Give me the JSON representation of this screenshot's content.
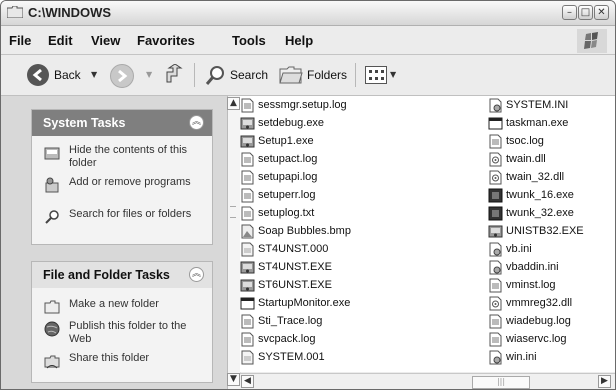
{
  "window": {
    "title": "C:\\WINDOWS"
  },
  "menu": [
    "File",
    "Edit",
    "View",
    "Favorites",
    "Tools",
    "Help"
  ],
  "toolbar": {
    "back": "Back",
    "search": "Search",
    "folders": "Folders"
  },
  "system_tasks": {
    "title": "System Tasks",
    "items": [
      {
        "label": "Hide the contents of this folder",
        "icon": "folder-hide-icon"
      },
      {
        "label": "Add or remove programs",
        "icon": "add-remove-programs-icon"
      },
      {
        "label": "Search for files or folders",
        "icon": "search-icon"
      }
    ]
  },
  "file_folder_tasks": {
    "title": "File and Folder Tasks",
    "items": [
      {
        "label": "Make a new folder",
        "icon": "new-folder-icon"
      },
      {
        "label": "Publish this folder to the Web",
        "icon": "globe-icon"
      },
      {
        "label": "Share this folder",
        "icon": "share-icon"
      }
    ]
  },
  "files_col1": [
    {
      "name": "sessmgr.setup.log",
      "icon": "text-file"
    },
    {
      "name": "setdebug.exe",
      "icon": "exe"
    },
    {
      "name": "Setup1.exe",
      "icon": "exe"
    },
    {
      "name": "setupact.log",
      "icon": "text-file"
    },
    {
      "name": "setupapi.log",
      "icon": "text-file"
    },
    {
      "name": "setuperr.log",
      "icon": "text-file"
    },
    {
      "name": "setuplog.txt",
      "icon": "text-file"
    },
    {
      "name": "Soap Bubbles.bmp",
      "icon": "image"
    },
    {
      "name": "ST4UNST.000",
      "icon": "generic"
    },
    {
      "name": "ST4UNST.EXE",
      "icon": "exe"
    },
    {
      "name": "ST6UNST.EXE",
      "icon": "exe"
    },
    {
      "name": "StartupMonitor.exe",
      "icon": "exe-window"
    },
    {
      "name": "Sti_Trace.log",
      "icon": "text-file"
    },
    {
      "name": "svcpack.log",
      "icon": "text-file"
    },
    {
      "name": "SYSTEM.001",
      "icon": "generic"
    }
  ],
  "files_col2": [
    {
      "name": "SYSTEM.INI",
      "icon": "ini"
    },
    {
      "name": "taskman.exe",
      "icon": "exe-window"
    },
    {
      "name": "tsoc.log",
      "icon": "text-file"
    },
    {
      "name": "twain.dll",
      "icon": "dll"
    },
    {
      "name": "twain_32.dll",
      "icon": "dll"
    },
    {
      "name": "twunk_16.exe",
      "icon": "exe-dark"
    },
    {
      "name": "twunk_32.exe",
      "icon": "exe-dark"
    },
    {
      "name": "UNISTB32.EXE",
      "icon": "exe"
    },
    {
      "name": "vb.ini",
      "icon": "ini"
    },
    {
      "name": "vbaddin.ini",
      "icon": "ini"
    },
    {
      "name": "vminst.log",
      "icon": "text-file"
    },
    {
      "name": "vmmreg32.dll",
      "icon": "dll"
    },
    {
      "name": "wiadebug.log",
      "icon": "text-file"
    },
    {
      "name": "wiaservc.log",
      "icon": "text-file"
    },
    {
      "name": "win.ini",
      "icon": "ini"
    }
  ]
}
